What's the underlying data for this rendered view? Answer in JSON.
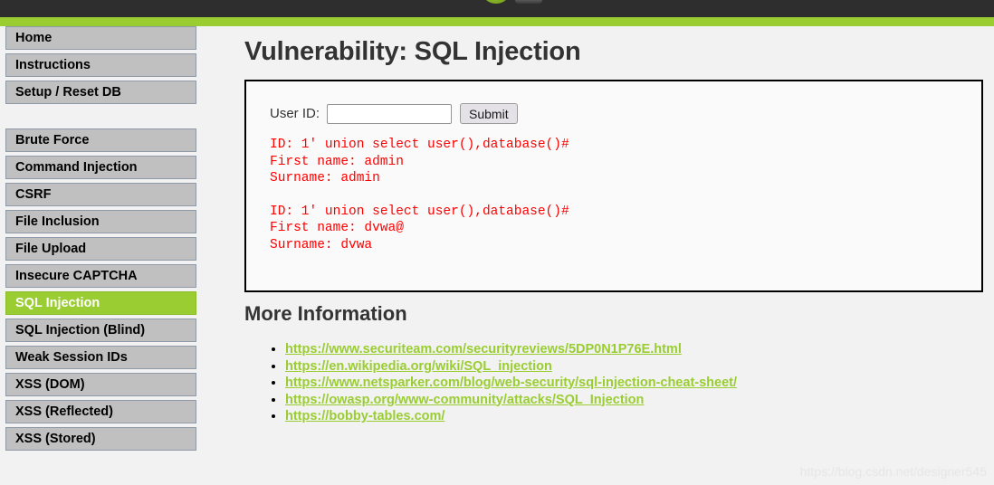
{
  "header": {
    "bar_color": "#2e2e2e",
    "accent_color": "#9acd32",
    "logo_name": "dvwa-logo"
  },
  "sidebar": {
    "groups": [
      {
        "items": [
          {
            "label": "Home",
            "active": false
          },
          {
            "label": "Instructions",
            "active": false
          },
          {
            "label": "Setup / Reset DB",
            "active": false
          }
        ]
      },
      {
        "items": [
          {
            "label": "Brute Force",
            "active": false
          },
          {
            "label": "Command Injection",
            "active": false
          },
          {
            "label": "CSRF",
            "active": false
          },
          {
            "label": "File Inclusion",
            "active": false
          },
          {
            "label": "File Upload",
            "active": false
          },
          {
            "label": "Insecure CAPTCHA",
            "active": false
          },
          {
            "label": "SQL Injection",
            "active": true
          },
          {
            "label": "SQL Injection (Blind)",
            "active": false
          },
          {
            "label": "Weak Session IDs",
            "active": false
          },
          {
            "label": "XSS (DOM)",
            "active": false
          },
          {
            "label": "XSS (Reflected)",
            "active": false
          },
          {
            "label": "XSS (Stored)",
            "active": false
          }
        ]
      }
    ]
  },
  "main": {
    "page_title": "Vulnerability: SQL Injection",
    "form": {
      "label": "User ID:",
      "input_value": "",
      "input_placeholder": "",
      "submit_label": "Submit"
    },
    "results_color": "#ff0000",
    "results": [
      {
        "id_line": "ID: 1' union select user(),database()#",
        "first_name_line": "First name: admin",
        "surname_line": "Surname: admin"
      },
      {
        "id_line": "ID: 1' union select user(),database()#",
        "first_name_line": "First name: dvwa@",
        "surname_line": "Surname: dvwa"
      }
    ],
    "more_information": {
      "heading": "More Information",
      "link_color": "#9acd32",
      "links": [
        "https://www.securiteam.com/securityreviews/5DP0N1P76E.html",
        "https://en.wikipedia.org/wiki/SQL_injection",
        "https://www.netsparker.com/blog/web-security/sql-injection-cheat-sheet/",
        "https://owasp.org/www-community/attacks/SQL_Injection",
        "https://bobby-tables.com/"
      ]
    }
  },
  "watermark": {
    "text": "https://blog.csdn.net/designer545"
  }
}
